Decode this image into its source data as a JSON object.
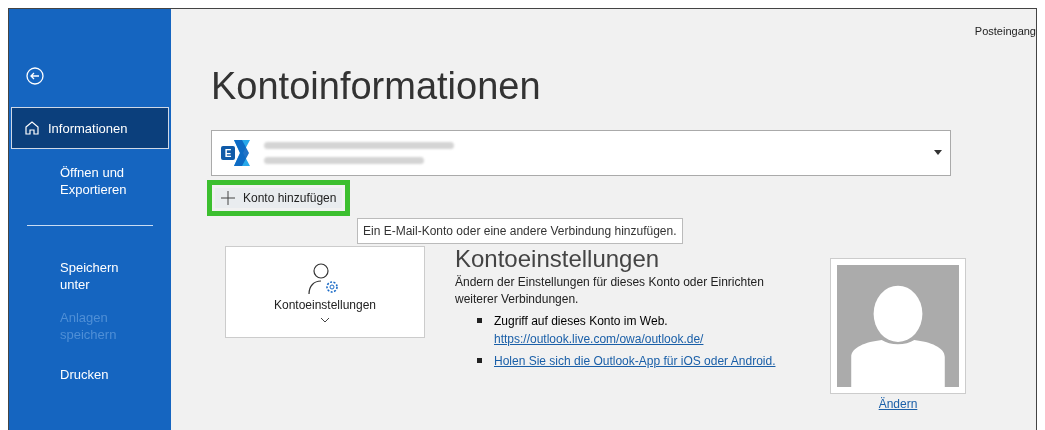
{
  "top_bar": {
    "label": "Posteingang"
  },
  "sidebar": {
    "sections": [
      [
        {
          "label": "Informationen",
          "kind": "home",
          "selected": true,
          "disabled": false
        },
        {
          "label": "Öffnen und Exportieren",
          "kind": "text",
          "selected": false,
          "disabled": false
        }
      ],
      [
        {
          "label": "Speichern unter",
          "kind": "text",
          "selected": false,
          "disabled": false
        },
        {
          "label": "Anlagen speichern",
          "kind": "text",
          "selected": false,
          "disabled": true
        },
        {
          "label": "Drucken",
          "kind": "text",
          "selected": false,
          "disabled": false
        }
      ]
    ]
  },
  "page_title": "Kontoinformationen",
  "account": {
    "logo_letter": "E"
  },
  "add_account": {
    "label": "Konto hinzufügen",
    "highlighted": true
  },
  "tooltip": "Ein E-Mail-Konto oder eine andere Verbindung hinzufügen.",
  "settings_card": {
    "label": "Kontoeinstellungen"
  },
  "settings_info": {
    "heading": "Kontoeinstellungen",
    "description": "Ändern der Einstellungen für dieses Konto oder Einrichten weiterer Verbindungen.",
    "bullets": [
      {
        "text": "Zugriff auf dieses Konto im Web.",
        "link": "https://outlook.live.com/owa/outlook.de/"
      },
      {
        "link": "Holen Sie sich die Outlook-App für iOS oder Android."
      }
    ]
  },
  "profile": {
    "change_link": "Ändern"
  }
}
